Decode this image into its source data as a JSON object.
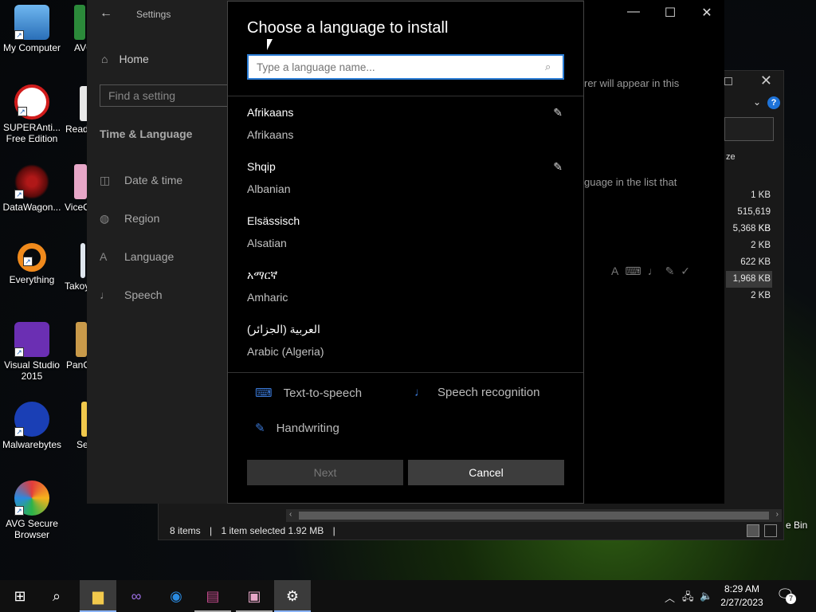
{
  "desktop": {
    "icons": [
      {
        "label_line1": "My Computer",
        "label_line2": ""
      },
      {
        "label_line1": "SUPERAnti...",
        "label_line2": "Free Edition"
      },
      {
        "label_line1": "DataWagon...",
        "label_line2": ""
      },
      {
        "label_line1": "Everything",
        "label_line2": ""
      },
      {
        "label_line1": "Visual Studio",
        "label_line2": "2015"
      },
      {
        "label_line1": "Malwarebytes",
        "label_line2": ""
      },
      {
        "label_line1": "AVG Secure",
        "label_line2": "Browser"
      }
    ],
    "partial_labels": [
      "AVG A",
      "Read",
      "ViceC",
      "Takoy",
      "PanC",
      "Se"
    ],
    "recycle_partial": "e Bin"
  },
  "explorer": {
    "column_header": "ze",
    "sizes": [
      "1 KB",
      "515,619 KB",
      "5,368 KB",
      "2 KB",
      "622 KB",
      "1,968 KB",
      "2 KB"
    ],
    "selected_index": 5,
    "status_items": "8 items",
    "status_selected": "1 item selected  1.92 MB"
  },
  "settings": {
    "window_title": "Settings",
    "home_label": "Home",
    "find_placeholder": "Find a setting",
    "section_title": "Time & Language",
    "nav_items": [
      "Date & time",
      "Region",
      "Language",
      "Speech"
    ],
    "main_text_1": "rer will appear in this",
    "main_text_2": "guage in the list that"
  },
  "dialog": {
    "title": "Choose a language to install",
    "search_placeholder": "Type a language name...",
    "languages": [
      {
        "native": "Afrikaans",
        "english": "Afrikaans",
        "has_handwriting": true
      },
      {
        "native": "Shqip",
        "english": "Albanian",
        "has_handwriting": true
      },
      {
        "native": "Elsässisch",
        "english": "Alsatian",
        "has_handwriting": false
      },
      {
        "native": "አማርኛ",
        "english": "Amharic",
        "has_handwriting": false
      },
      {
        "native": "العربية (الجزائر)",
        "english": "Arabic (Algeria)",
        "has_handwriting": false
      }
    ],
    "features": {
      "tts": "Text-to-speech",
      "speech": "Speech recognition",
      "handwriting": "Handwriting"
    },
    "next_label": "Next",
    "cancel_label": "Cancel"
  },
  "taskbar": {
    "time": "8:29 AM",
    "date": "2/27/2023",
    "notification_count": "7"
  },
  "colors": {
    "accent": "#2b7dd6",
    "dialog_bg": "#000000",
    "settings_bg": "#1f1f1f"
  }
}
